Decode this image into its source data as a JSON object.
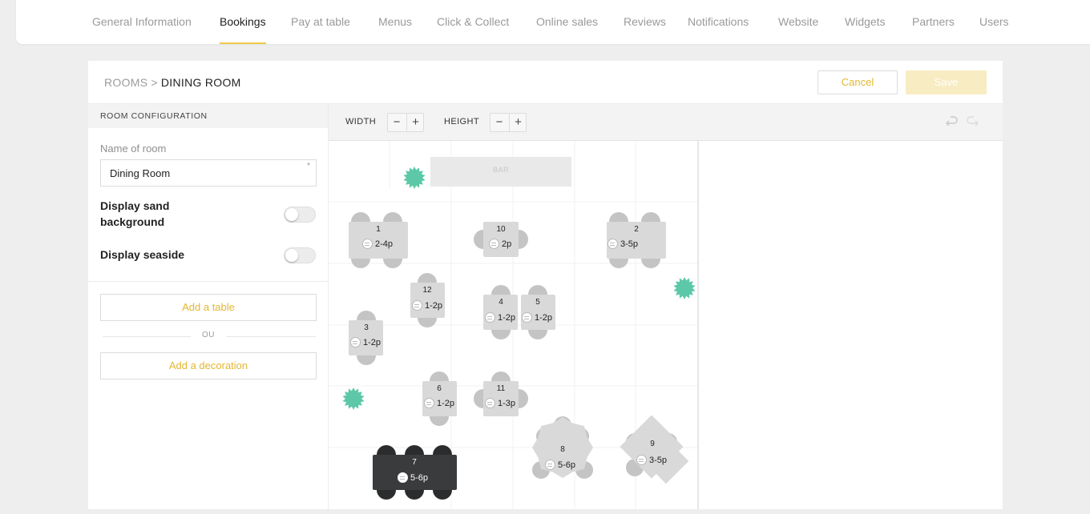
{
  "nav": {
    "tabs": [
      {
        "label": "General Information",
        "active": false
      },
      {
        "label": "Bookings",
        "active": true
      },
      {
        "label": "Pay at table",
        "active": false
      },
      {
        "label": "Menus",
        "active": false
      },
      {
        "label": "Click & Collect",
        "active": false
      },
      {
        "label": "Online sales",
        "active": false
      },
      {
        "label": "Reviews",
        "active": false
      },
      {
        "label": "Notifications",
        "active": false
      },
      {
        "label": "Website",
        "active": false
      },
      {
        "label": "Widgets",
        "active": false
      },
      {
        "label": "Partners",
        "active": false
      },
      {
        "label": "Users",
        "active": false
      }
    ]
  },
  "header": {
    "breadcrumb_root": "ROOMS",
    "breadcrumb_sep": ">",
    "breadcrumb_current": "DINING ROOM",
    "cancel_label": "Cancel",
    "save_label": "Save"
  },
  "config": {
    "title": "ROOM CONFIGURATION",
    "name_label": "Name of room",
    "name_value": "Dining Room",
    "required_mark": "*",
    "sand_label": "Display sand background",
    "sand_on": false,
    "seaside_label": "Display seaside",
    "seaside_on": false,
    "add_table_label": "Add a table",
    "or_label": "OU",
    "add_decoration_label": "Add a decoration"
  },
  "toolbar": {
    "width_label": "WIDTH",
    "height_label": "HEIGHT",
    "minus": "−",
    "plus": "+",
    "undo_icon": "undo-icon",
    "redo_icon": "redo-icon"
  },
  "floor": {
    "bar_label": "BAR",
    "tables": [
      {
        "number": "1",
        "capacity": "2-4p",
        "shape": "rect4",
        "selected": false
      },
      {
        "number": "10",
        "capacity": "2p",
        "shape": "square2",
        "selected": false
      },
      {
        "number": "2",
        "capacity": "3-5p",
        "shape": "rect4",
        "selected": false
      },
      {
        "number": "12",
        "capacity": "1-2p",
        "shape": "square2v",
        "selected": false
      },
      {
        "number": "4",
        "capacity": "1-2p",
        "shape": "square2v",
        "selected": false
      },
      {
        "number": "5",
        "capacity": "1-2p",
        "shape": "square2v",
        "selected": false
      },
      {
        "number": "3",
        "capacity": "1-2p",
        "shape": "square2v",
        "selected": false
      },
      {
        "number": "6",
        "capacity": "1-2p",
        "shape": "square2v",
        "selected": false
      },
      {
        "number": "11",
        "capacity": "1-3p",
        "shape": "square3",
        "selected": false
      },
      {
        "number": "7",
        "capacity": "5-6p",
        "shape": "long6",
        "selected": true
      },
      {
        "number": "8",
        "capacity": "5-6p",
        "shape": "round",
        "selected": false
      },
      {
        "number": "9",
        "capacity": "3-5p",
        "shape": "diamond",
        "selected": false
      }
    ],
    "plant_icon": "plant-icon",
    "plant_color": "#5cc8a8",
    "table_color": "#d9d9d9",
    "chair_color": "#c4c4c4",
    "selected_color": "#3a3b3d"
  }
}
